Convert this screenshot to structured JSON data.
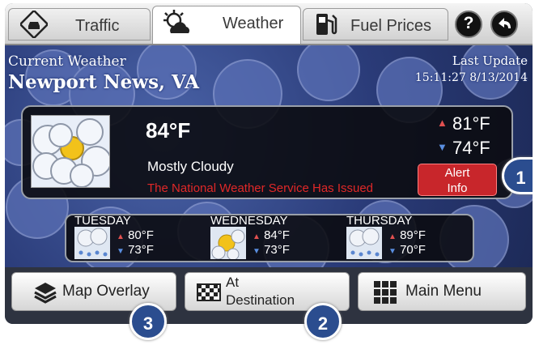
{
  "tabs": [
    {
      "label": "Traffic",
      "icon": "car-icon"
    },
    {
      "label": "Weather",
      "icon": "weather-icon"
    },
    {
      "label": "Fuel Prices",
      "icon": "fuel-pump-icon"
    }
  ],
  "header_buttons": {
    "help": "?",
    "back_icon": "back-arrow-icon"
  },
  "location": {
    "label": "Current Weather",
    "city": "Newport News, VA"
  },
  "last_update": {
    "label": "Last Update",
    "value": "15:11:27  8/13/2014"
  },
  "current": {
    "temp": "84°F",
    "condition": "Mostly Cloudy",
    "alert_text": "The National Weather Service Has Issued",
    "high": "81°F",
    "low": "74°F",
    "alert_button": {
      "line1": "Alert",
      "line2": "Info"
    }
  },
  "forecast": [
    {
      "day": "TUESDAY",
      "high": "80°F",
      "low": "73°F",
      "icon": "rain-icon"
    },
    {
      "day": "WEDNESDAY",
      "high": "84°F",
      "low": "73°F",
      "icon": "partly-sunny-icon"
    },
    {
      "day": "THURSDAY",
      "high": "89°F",
      "low": "70°F",
      "icon": "rain-icon"
    }
  ],
  "buttons": {
    "map_overlay": "Map Overlay",
    "destination_line1": "At",
    "destination_line2": "Destination",
    "main_menu": "Main Menu"
  },
  "callouts": [
    "1",
    "2",
    "3"
  ],
  "colors": {
    "accent_red": "#c8262b",
    "callout_blue": "#2b4d8f",
    "high_arrow": "#e05050",
    "low_arrow": "#5a8ee0"
  }
}
